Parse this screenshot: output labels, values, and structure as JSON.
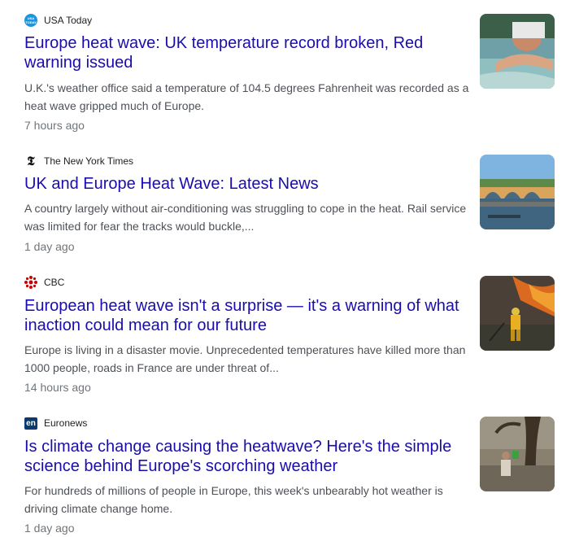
{
  "articles": [
    {
      "source": "USA Today",
      "source_icon": "usa-today-logo-icon",
      "title": "Europe heat wave: UK temperature record broken, Red warning issued",
      "snippet": "U.K.'s weather office said a temperature of 104.5 degrees Fahrenheit was recorded as a heat wave gripped much of Europe.",
      "time": "7 hours ago",
      "thumbnail": "man-cooling-off-at-fountain-image"
    },
    {
      "source": "The New York Times",
      "source_icon": "nyt-logo-icon",
      "title": "UK and Europe Heat Wave: Latest News",
      "snippet": "A country largely without air-conditioning was struggling to cope in the heat. Rail service was limited for fear the tracks would buckle,...",
      "time": "1 day ago",
      "thumbnail": "stone-bridge-over-river-image"
    },
    {
      "source": "CBC",
      "source_icon": "cbc-logo-icon",
      "title": "European heat wave isn't a surprise — it's a warning of what inaction could mean for our future",
      "snippet": "Europe is living in a disaster movie. Unprecedented temperatures have killed more than 1000 people, roads in France are under threat of...",
      "time": "14 hours ago",
      "thumbnail": "firefighter-at-wildfire-image"
    },
    {
      "source": "Euronews",
      "source_icon": "euronews-logo-icon",
      "title": "Is climate change causing the heatwave? Here's the simple science behind Europe's scorching weather",
      "snippet": "For hundreds of millions of people in Europe, this week's unbearably hot weather is driving climate change home.",
      "time": "1 day ago",
      "thumbnail": "person-under-tree-in-drought-image"
    }
  ],
  "logo_text": {
    "usa_today": "USA TODAY",
    "euronews": "en"
  }
}
